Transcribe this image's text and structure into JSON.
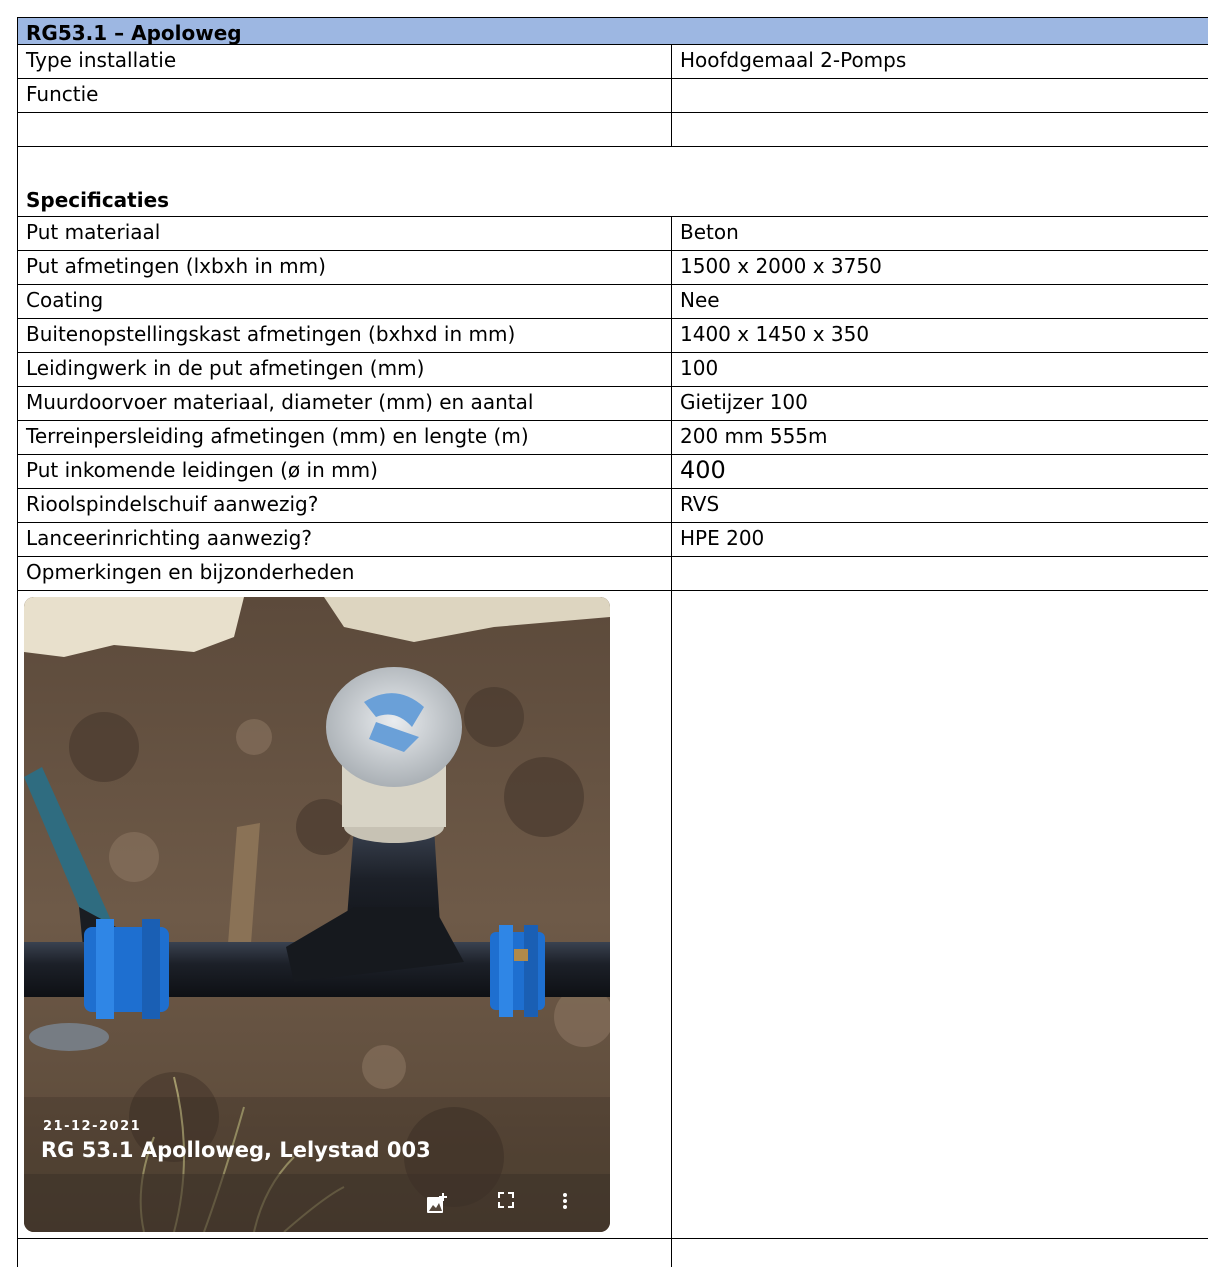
{
  "header": {
    "title": "RG53.1 – Apoloweg"
  },
  "general": [
    {
      "label": "Type installatie",
      "value": "Hoofdgemaal 2-Pomps"
    },
    {
      "label": "Functie",
      "value": ""
    },
    {
      "label": "",
      "value": ""
    }
  ],
  "specifications": {
    "heading": "Specificaties",
    "rows": [
      {
        "label": "Put materiaal",
        "value": "Beton"
      },
      {
        "label": "Put afmetingen (lxbxh in mm)",
        "value": "1500 x 2000 x 3750"
      },
      {
        "label": "Coating",
        "value": "Nee"
      },
      {
        "label": "Buitenopstellingskast afmetingen (bxhxd in mm)",
        "value": "1400 x 1450 x 350"
      },
      {
        "label": "Leidingwerk in de put afmetingen (mm)",
        "value": "100"
      },
      {
        "label": "Muurdoorvoer materiaal, diameter (mm) en aantal",
        "value": "Gietijzer 100"
      },
      {
        "label": "Terreinpersleiding afmetingen (mm) en lengte (m)",
        "value": "200 mm 555m"
      },
      {
        "label": "Put inkomende leidingen (ø in mm)",
        "value": "400"
      },
      {
        "label": "Rioolspindelschuif aanwezig?",
        "value": "RVS"
      },
      {
        "label": "Lanceerinrichting aanwezig?",
        "value": "HPE 200"
      },
      {
        "label": "Opmerkingen en bijzonderheden",
        "value": ""
      }
    ]
  },
  "photo": {
    "date": "21-12-2021",
    "caption": "RG 53.1 Apolloweg, Lelystad 003",
    "toolbar_icons": [
      "add-photo-icon",
      "fullscreen-icon",
      "more-vert-icon"
    ]
  },
  "colors": {
    "header_bg": "#9DB7E2",
    "fitting_blue": "#1E6FD0",
    "pipe_black": "#1a1d22"
  }
}
